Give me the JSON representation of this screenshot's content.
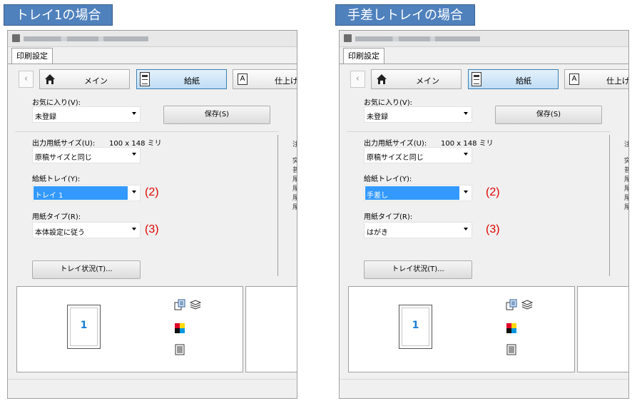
{
  "panels": [
    {
      "case_title": "トレイ1の場合",
      "tab_label": "印刷設定",
      "nav": {
        "prev_symbol": "‹",
        "main_tab": "メイン",
        "paper_tab": "給紙",
        "finish_tab": "仕上げ"
      },
      "favorites_label": "お気に入り(V):",
      "favorites_value": "未登録",
      "save_button": "保存(S)",
      "output_size_label": "出力用紙サイズ(U):",
      "output_size_value": "100 x 148 ミリ",
      "size_combo_value": "原稿サイズと同じ",
      "tray_label": "給紙トレイ(Y):",
      "tray_value": "トレイ 1",
      "paper_type_label": "用紙タイプ(R):",
      "paper_type_value": "本体設定に従う",
      "annotation_2": "(2)",
      "annotation_3": "(3)",
      "tray_status_button": "トレイ状況(T)...",
      "preview_page_number": "1",
      "right_column_fragments": [
        "注",
        "突",
        "普",
        "厚",
        "厚",
        "厚",
        "厚"
      ]
    },
    {
      "case_title": "手差しトレイの場合",
      "tab_label": "印刷設定",
      "nav": {
        "prev_symbol": "‹",
        "main_tab": "メイン",
        "paper_tab": "給紙",
        "finish_tab": "仕上げ"
      },
      "favorites_label": "お気に入り(V):",
      "favorites_value": "未登録",
      "save_button": "保存(S)",
      "output_size_label": "出力用紙サイズ(U):",
      "output_size_value": "100 x 148 ミリ",
      "size_combo_value": "原稿サイズと同じ",
      "tray_label": "給紙トレイ(Y):",
      "tray_value": "手差し",
      "paper_type_label": "用紙タイプ(R):",
      "paper_type_value": "はがき",
      "annotation_2": "(2)",
      "annotation_3": "(3)",
      "tray_status_button": "トレイ状況(T)...",
      "preview_page_number": "1",
      "right_column_fragments": [
        "注",
        "突",
        "普",
        "厚",
        "厚",
        "厚",
        "厚"
      ]
    }
  ],
  "colors": {
    "case_title_bg": "#4f81bd",
    "selection": "#3399ff",
    "annotation": "#e00000",
    "active_tab": "#bfddf5"
  },
  "icons": [
    "printer-icon",
    "home-icon",
    "paper-tray-icon",
    "finishing-icon",
    "copy-icon",
    "stack-icon",
    "color-icon",
    "document-icon"
  ]
}
